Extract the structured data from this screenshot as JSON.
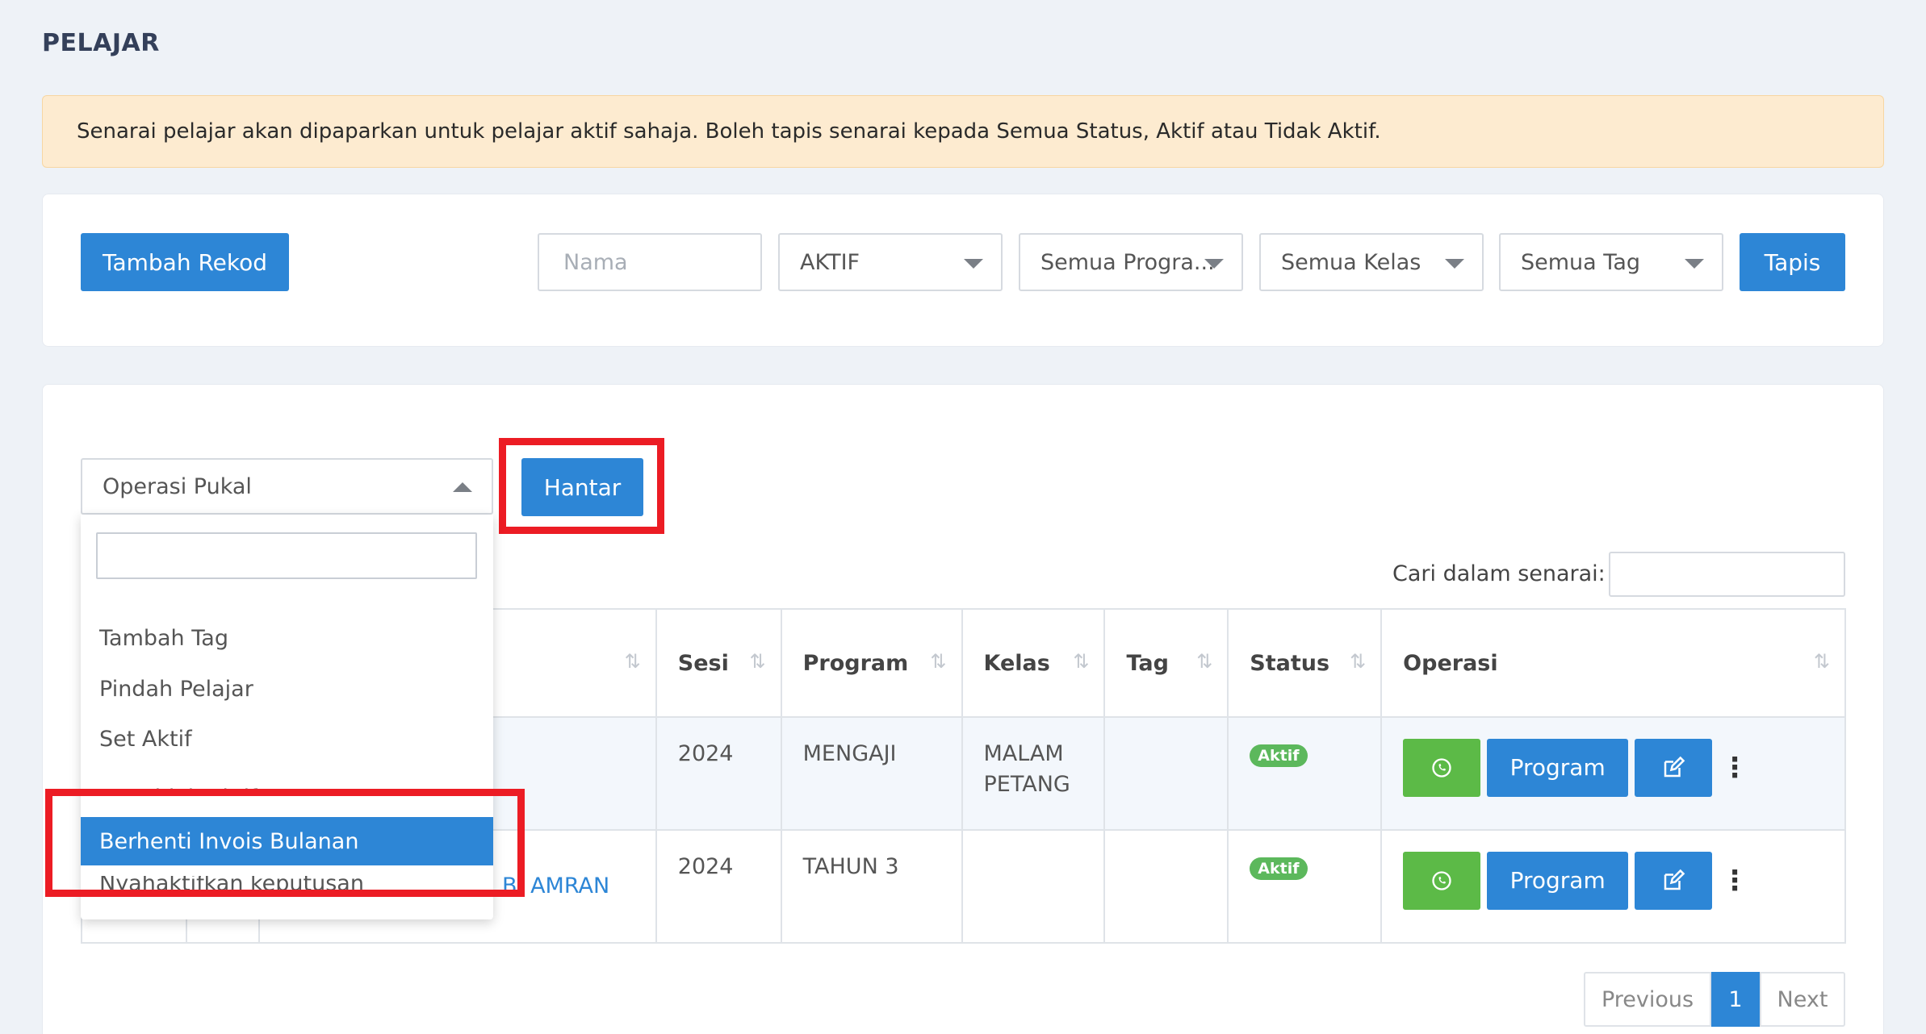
{
  "page": {
    "title": "PELAJAR"
  },
  "alert": {
    "text": "Senarai pelajar akan dipaparkan untuk pelajar aktif sahaja. Boleh tapis senarai kepada Semua Status, Aktif atau Tidak Aktif."
  },
  "filters": {
    "add_label": "Tambah Rekod",
    "name_placeholder": "Nama",
    "status": "AKTIF",
    "program": "Semua Progra...",
    "kelas": "Semua Kelas",
    "tag": "Semua Tag",
    "filter_label": "Tapis"
  },
  "bulk": {
    "select_label": "Operasi Pukal",
    "send_label": "Hantar",
    "options": [
      "Tambah Tag",
      "Pindah Pelajar",
      "Set Aktif",
      "Set Tidak Aktif",
      "Berhenti Invois Bulanan",
      "Nyahaktifkan keputusan peperiksaan"
    ],
    "selected_option": "Berhenti Invois Bulanan"
  },
  "search": {
    "label": "Cari dalam senarai:"
  },
  "table": {
    "headers": [
      "Sesi",
      "Program",
      "Kelas",
      "Tag",
      "Status",
      "Operasi"
    ],
    "sort_icon": "⇅",
    "rows": [
      {
        "sesi": "2024",
        "program": "MENGAJI",
        "kelas": "MALAM PETANG",
        "tag": "",
        "status": "Aktif",
        "name_fragment": ""
      },
      {
        "sesi": "2024",
        "program": "TAHUN 3",
        "kelas": "",
        "tag": "",
        "status": "Aktif",
        "name_fragment": "BI AMRAN"
      }
    ],
    "program_btn": "Program"
  },
  "pagination": {
    "prev": "Previous",
    "current": "1",
    "next": "Next"
  },
  "colors": {
    "primary": "#2d86d6",
    "whatsapp": "#5cba47",
    "highlight": "#ec1c24",
    "badge": "#5cb85c"
  }
}
